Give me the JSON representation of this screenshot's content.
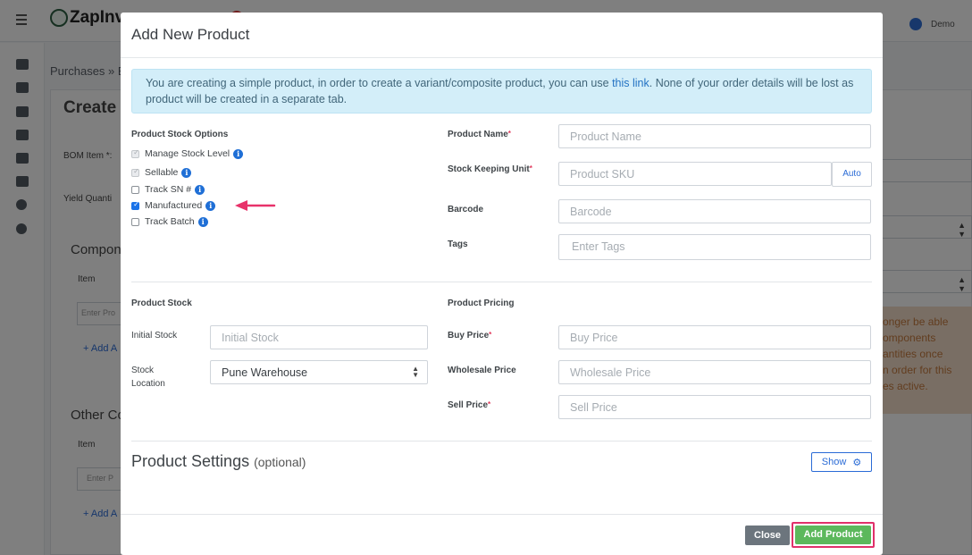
{
  "app": {
    "brand": "ZapInv",
    "user": "Demo",
    "breadcrumb": "Purchases  »  B",
    "page_title": "Create",
    "bom_item_label": "BOM Item *:",
    "yield_label": "Yield Quanti",
    "components_heading": "Compon",
    "other_heading": "Other Co",
    "item_col": "Item",
    "item_col2": "Item",
    "enter_placeholder": "Enter Pro",
    "enter_placeholder2": "Enter P",
    "add_link": "+ Add A",
    "add_link2": "+ Add A",
    "warning_lines": [
      "onger be able",
      "omponents",
      "antities once",
      "n order for this",
      "es active."
    ]
  },
  "modal": {
    "title": "Add New Product",
    "alert": {
      "text_before": "You are creating a simple product, in order to create a variant/composite product, you can use ",
      "link": "this link",
      "text_after": ". None of your order details will be lost as product will be created in a separate tab."
    },
    "stock_options": {
      "heading": "Product Stock Options",
      "items": [
        {
          "label": "Manage Stock Level",
          "checked": true,
          "disabled": true
        },
        {
          "label": "Sellable",
          "checked": true,
          "disabled": true
        },
        {
          "label": "Track SN #",
          "checked": false,
          "disabled": false
        },
        {
          "label": "Manufactured",
          "checked": true,
          "disabled": false
        },
        {
          "label": "Track Batch",
          "checked": false,
          "disabled": false
        }
      ]
    },
    "product_name": {
      "label": "Product Name",
      "placeholder": "Product Name"
    },
    "sku": {
      "label": "Stock Keeping Unit",
      "placeholder": "Product SKU",
      "auto_label": "Auto"
    },
    "barcode": {
      "label": "Barcode",
      "placeholder": "Barcode"
    },
    "tags": {
      "label": "Tags",
      "placeholder": "Enter Tags"
    },
    "stock": {
      "heading": "Product Stock",
      "initial_label": "Initial Stock",
      "initial_placeholder": "Initial Stock",
      "location_label_1": "Stock",
      "location_label_2": "Location",
      "location_value": "Pune Warehouse"
    },
    "pricing": {
      "heading": "Product Pricing",
      "buy_label": "Buy Price",
      "buy_placeholder": "Buy Price",
      "wholesale_label": "Wholesale Price",
      "wholesale_placeholder": "Wholesale Price",
      "sell_label": "Sell Price",
      "sell_placeholder": "Sell Price"
    },
    "settings": {
      "title": "Product Settings",
      "optional": "(optional)",
      "show_label": "Show"
    },
    "footer": {
      "close_label": "Close",
      "add_label": "Add Product"
    },
    "required_mark": "*",
    "info_icon": "i"
  },
  "colors": {
    "accent": "#1f6fd6",
    "success": "#5cb85c",
    "highlight": "#e0306a",
    "arrow": "#e8326a"
  }
}
